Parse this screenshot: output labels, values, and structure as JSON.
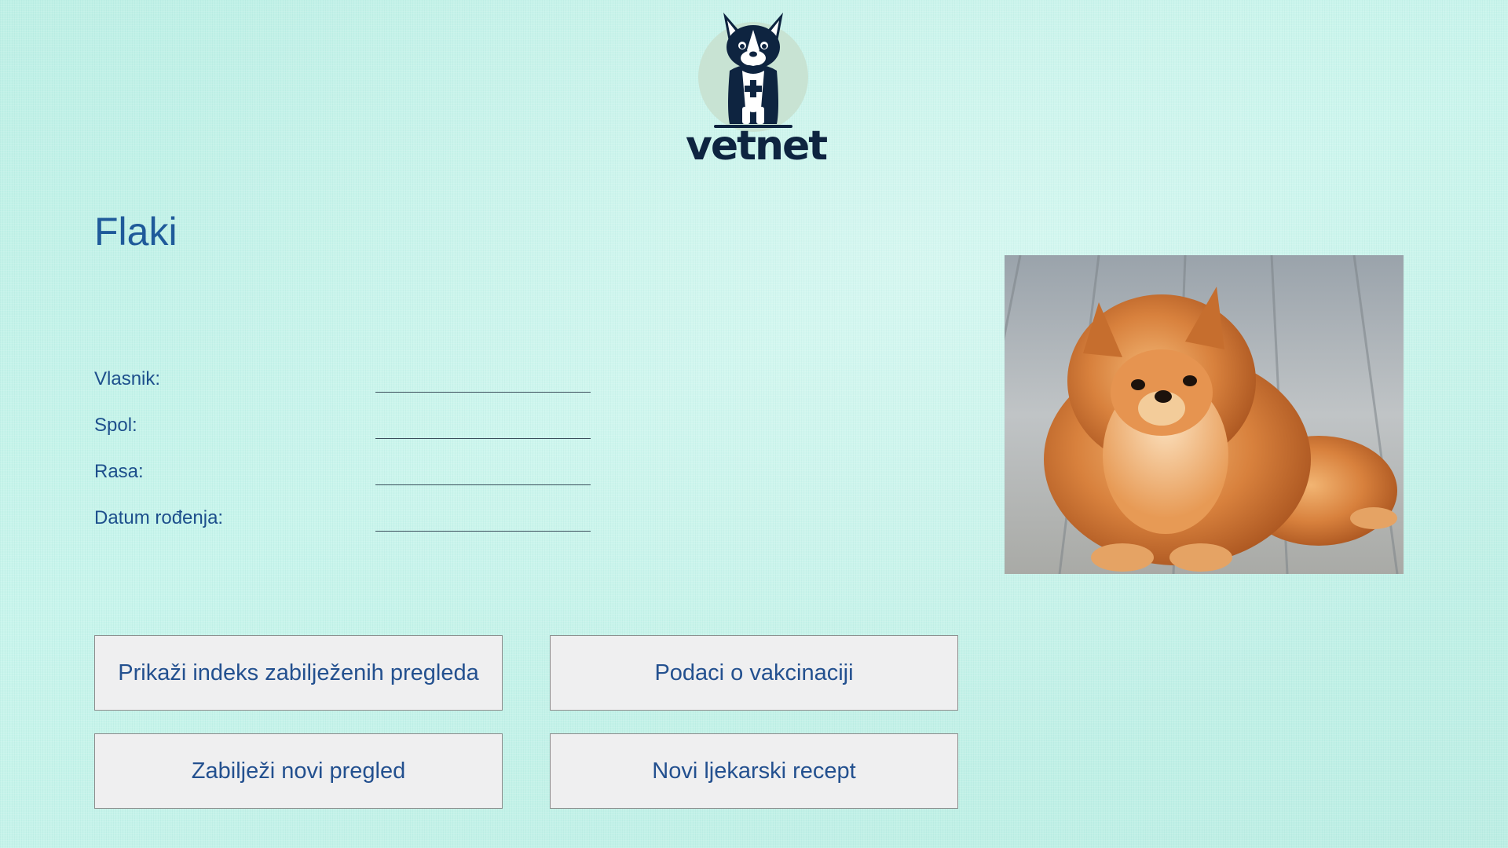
{
  "brand": {
    "name": "vetnet",
    "logo_icon": "dog-with-medical-cross-icon",
    "colors": {
      "dark": "#0e2440",
      "circle": "#c8e3d3"
    }
  },
  "pet": {
    "name": "Flaki",
    "photo_icon": "pomeranian-dog-photo"
  },
  "fields": [
    {
      "label": "Vlasnik:",
      "value": ""
    },
    {
      "label": "Spol:",
      "value": ""
    },
    {
      "label": "Rasa:",
      "value": ""
    },
    {
      "label": "Datum rođenja:",
      "value": ""
    }
  ],
  "buttons": {
    "show_exams": "Prikaži indeks zabilježenih pregleda",
    "vaccination": "Podaci o vakcinaciji",
    "new_exam": "Zabilježi novi pregled",
    "new_prescription": "Novi ljekarski recept"
  },
  "theme": {
    "background": "#c4f3ea",
    "text_blue": "#1f5a9a",
    "button_bg": "#efeff0"
  }
}
